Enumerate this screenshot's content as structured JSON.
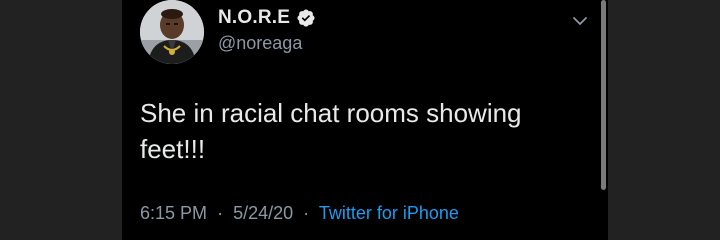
{
  "tweet": {
    "display_name": "N.O.R.E",
    "handle": "@noreaga",
    "verified_icon": "verified-badge-icon",
    "menu_icon": "chevron-down-icon",
    "text_line1": "She in racial chat rooms showing",
    "text_line2": "feet!!!",
    "time": "6:15 PM",
    "separator": "·",
    "date": "5/24/20",
    "source": "Twitter for iPhone"
  },
  "colors": {
    "background": "#000000",
    "outer_background": "#222222",
    "primary_text": "#e7e9ea",
    "secondary_text": "#8b98a5",
    "link": "#1d9bf0"
  }
}
